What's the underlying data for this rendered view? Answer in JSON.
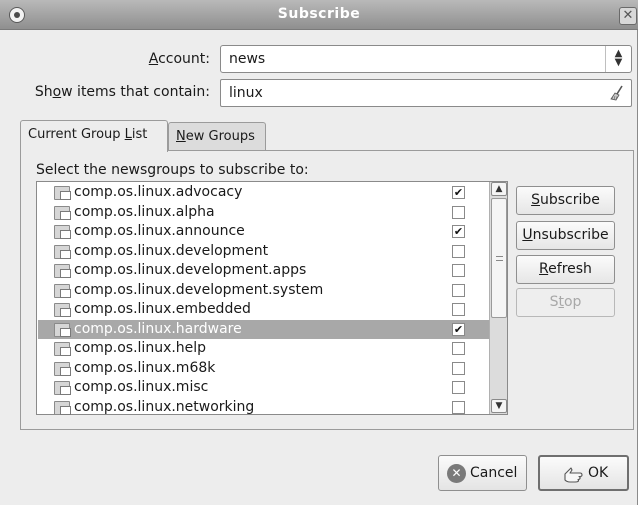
{
  "window": {
    "title": "Subscribe",
    "close_glyph": "✕",
    "menu_icon": "window-menu-icon"
  },
  "form": {
    "account_label": {
      "pre": "",
      "mnemonic": "A",
      "post": "ccount:"
    },
    "account_value": "news",
    "filter_label": {
      "pre": "Sh",
      "mnemonic": "o",
      "post": "w items that contain:"
    },
    "filter_value": "linux",
    "clear_icon": "broom-icon"
  },
  "tabs": [
    {
      "pre": "Current Group ",
      "mnemonic": "L",
      "post": "ist",
      "active": true
    },
    {
      "pre": "",
      "mnemonic": "N",
      "post": "ew Groups",
      "active": false
    }
  ],
  "list_caption": "Select the newsgroups to subscribe to:",
  "groups": [
    {
      "name": "comp.os.linux.advocacy",
      "subscribed": true,
      "selected": false
    },
    {
      "name": "comp.os.linux.alpha",
      "subscribed": false,
      "selected": false
    },
    {
      "name": "comp.os.linux.announce",
      "subscribed": true,
      "selected": false
    },
    {
      "name": "comp.os.linux.development",
      "subscribed": false,
      "selected": false
    },
    {
      "name": "comp.os.linux.development.apps",
      "subscribed": false,
      "selected": false
    },
    {
      "name": "comp.os.linux.development.system",
      "subscribed": false,
      "selected": false
    },
    {
      "name": "comp.os.linux.embedded",
      "subscribed": false,
      "selected": false
    },
    {
      "name": "comp.os.linux.hardware",
      "subscribed": true,
      "selected": true
    },
    {
      "name": "comp.os.linux.help",
      "subscribed": false,
      "selected": false
    },
    {
      "name": "comp.os.linux.m68k",
      "subscribed": false,
      "selected": false
    },
    {
      "name": "comp.os.linux.misc",
      "subscribed": false,
      "selected": false
    },
    {
      "name": "comp.os.linux.networking",
      "subscribed": false,
      "selected": false
    }
  ],
  "side_buttons": {
    "subscribe": {
      "pre": "",
      "mnemonic": "S",
      "post": "ubscribe",
      "enabled": true
    },
    "unsubscribe": {
      "pre": "",
      "mnemonic": "U",
      "post": "nsubscribe",
      "enabled": true
    },
    "refresh": {
      "pre": "",
      "mnemonic": "R",
      "post": "efresh",
      "enabled": true
    },
    "stop": {
      "pre": "S",
      "mnemonic": "t",
      "post": "op",
      "enabled": false
    }
  },
  "footer": {
    "cancel_label": "Cancel",
    "ok_label": "OK",
    "cancel_icon": "cancel-icon",
    "ok_icon": "ok-hand-icon"
  },
  "colors": {
    "selection": "#a8a8a8",
    "titlebar": "#a3a3a3",
    "dialog_bg": "#ededed"
  }
}
